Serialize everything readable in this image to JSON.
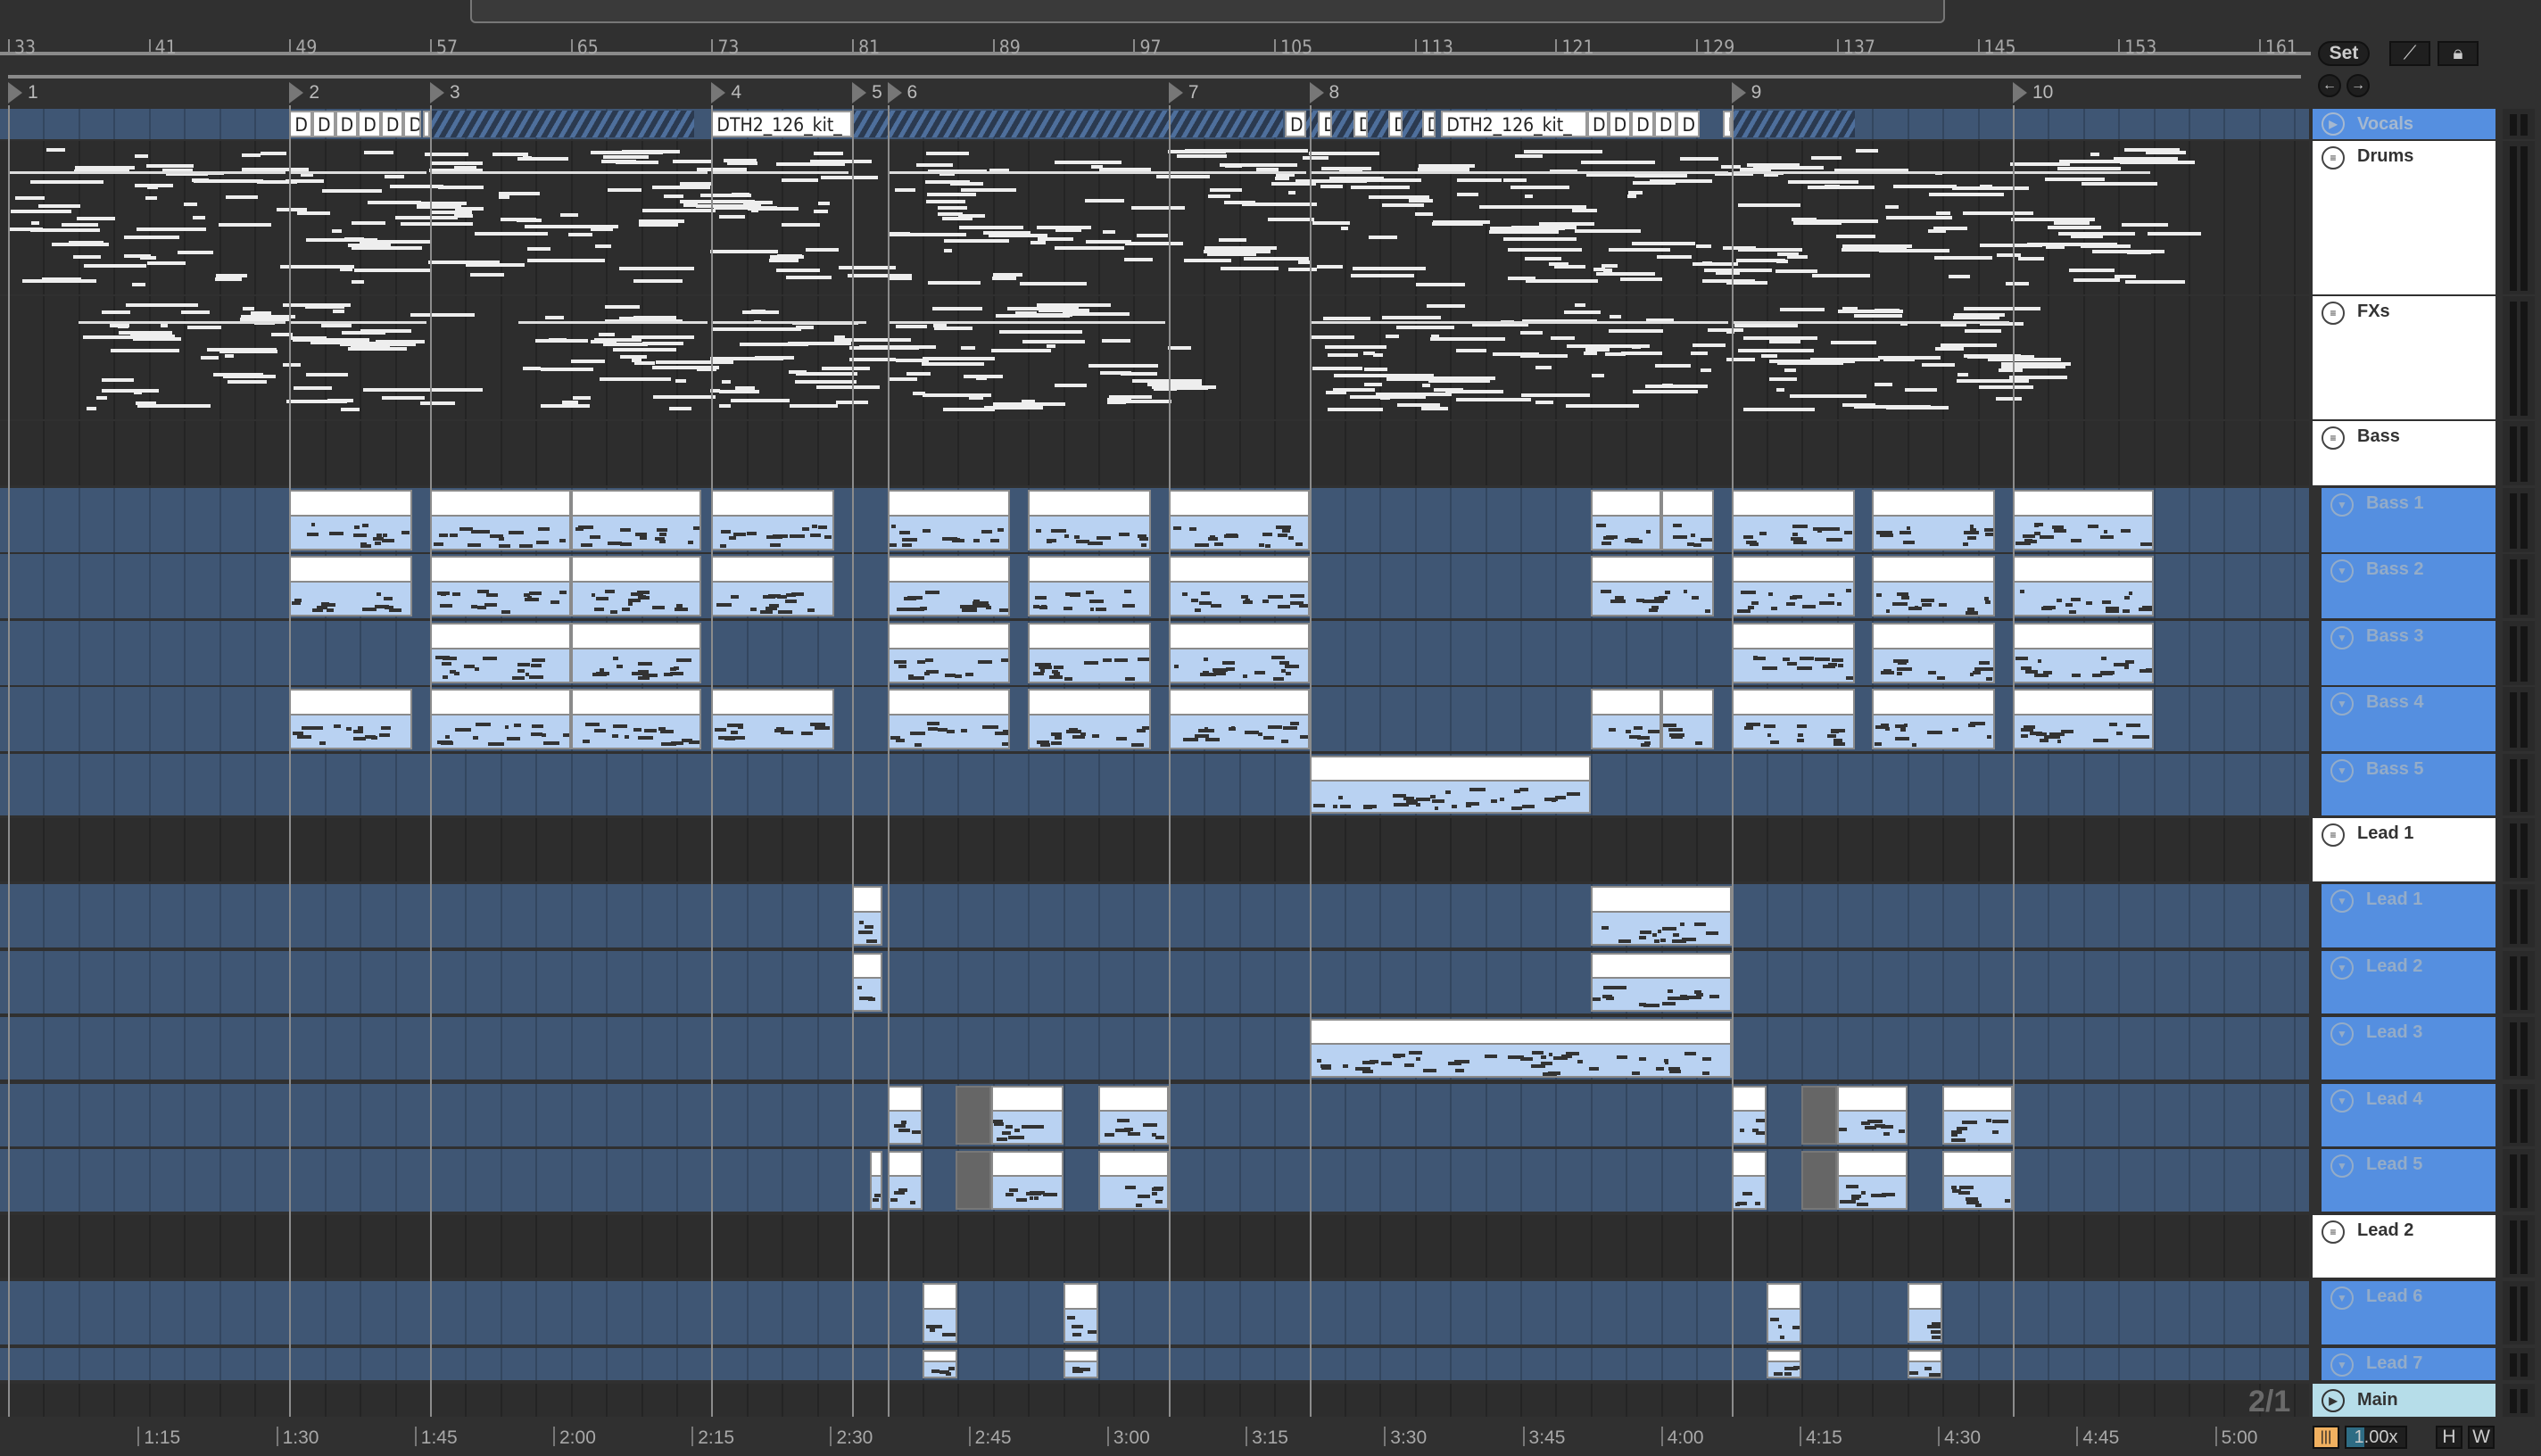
{
  "ruler": {
    "bars": [
      33,
      41,
      49,
      57,
      65,
      73,
      81,
      89,
      97,
      105,
      113,
      121,
      129,
      137,
      145,
      153,
      161
    ]
  },
  "locators": [
    {
      "label": "1",
      "bar": 33
    },
    {
      "label": "2",
      "bar": 49
    },
    {
      "label": "3",
      "bar": 57
    },
    {
      "label": "4",
      "bar": 73
    },
    {
      "label": "5",
      "bar": 81
    },
    {
      "label": "6",
      "bar": 83
    },
    {
      "label": "7",
      "bar": 99
    },
    {
      "label": "8",
      "bar": 107
    },
    {
      "label": "9",
      "bar": 131
    },
    {
      "label": "10",
      "bar": 147
    }
  ],
  "controls": {
    "set_label": "Set",
    "draw_icon": "draw-mode-icon",
    "lock_icon": "lock-icon",
    "prev_icon": "arrow-left-icon",
    "next_icon": "arrow-right-icon"
  },
  "time_signature": "2/1",
  "time_ruler": [
    {
      "label": "1:15",
      "sec": 75
    },
    {
      "label": "1:30",
      "sec": 90
    },
    {
      "label": "1:45",
      "sec": 105
    },
    {
      "label": "2:00",
      "sec": 120
    },
    {
      "label": "2:15",
      "sec": 135
    },
    {
      "label": "2:30",
      "sec": 150
    },
    {
      "label": "2:45",
      "sec": 165
    },
    {
      "label": "3:00",
      "sec": 180
    },
    {
      "label": "3:15",
      "sec": 195
    },
    {
      "label": "3:30",
      "sec": 210
    },
    {
      "label": "3:45",
      "sec": 225
    },
    {
      "label": "4:00",
      "sec": 240
    },
    {
      "label": "4:15",
      "sec": 255
    },
    {
      "label": "4:30",
      "sec": 270
    },
    {
      "label": "4:45",
      "sec": 285
    },
    {
      "label": "5:00",
      "sec": 300
    }
  ],
  "footer": {
    "tempo_follow_icon": "waveform-icon",
    "zoom": "1.00x",
    "h_label": "H",
    "w_label": "W"
  },
  "vocal_clips": [
    {
      "label": "D",
      "start": 49,
      "end": 50.3
    },
    {
      "label": "D",
      "start": 50.3,
      "end": 51.6
    },
    {
      "label": "D",
      "start": 51.6,
      "end": 52.9
    },
    {
      "label": "D",
      "start": 52.9,
      "end": 54.2
    },
    {
      "label": "D",
      "start": 54.2,
      "end": 55.5
    },
    {
      "label": "D",
      "start": 55.5,
      "end": 56.5
    },
    {
      "label": "D",
      "start": 56.6,
      "end": 57
    },
    {
      "label": "DTH2_126_kit_",
      "start": 73,
      "end": 81
    },
    {
      "label": "D",
      "start": 105.6,
      "end": 106.8
    },
    {
      "label": "D",
      "start": 107.5,
      "end": 108.3
    },
    {
      "label": "D",
      "start": 109.5,
      "end": 110.3
    },
    {
      "label": "D",
      "start": 111.5,
      "end": 112.3
    },
    {
      "label": "D",
      "start": 113.4,
      "end": 114.2
    },
    {
      "label": "DTH2_126_kit_",
      "start": 114.5,
      "end": 122.8
    },
    {
      "label": "D",
      "start": 122.8,
      "end": 124
    },
    {
      "label": "D",
      "start": 124,
      "end": 125.3
    },
    {
      "label": "D",
      "start": 125.3,
      "end": 126.6
    },
    {
      "label": "D",
      "start": 126.6,
      "end": 127.9
    },
    {
      "label": "D",
      "start": 127.9,
      "end": 129.2
    },
    {
      "label": "D",
      "start": 130.5,
      "end": 131
    }
  ],
  "vocal_hatch": [
    [
      57,
      72
    ],
    [
      81,
      105.5
    ],
    [
      106.8,
      113.4
    ],
    [
      131,
      138
    ]
  ],
  "tracks": [
    {
      "id": "vocals",
      "name": "Vocals",
      "kind": "vocal",
      "icon": "play-icon"
    },
    {
      "id": "drums",
      "name": "Drums",
      "kind": "group",
      "icon": "group-icon",
      "notes": [
        [
          33,
          49
        ],
        [
          49,
          57
        ],
        [
          57,
          73
        ],
        [
          73,
          81
        ],
        [
          83,
          107
        ],
        [
          107,
          131
        ],
        [
          131,
          155
        ]
      ]
    },
    {
      "id": "fxs",
      "name": "FXs",
      "kind": "group",
      "icon": "group-icon",
      "notes": [
        [
          37,
          49
        ],
        [
          49,
          57
        ],
        [
          62,
          73
        ],
        [
          73,
          82
        ],
        [
          83,
          99
        ],
        [
          107,
          131
        ],
        [
          131,
          147
        ]
      ]
    },
    {
      "id": "bass",
      "name": "Bass",
      "kind": "group",
      "icon": "group-icon"
    },
    {
      "id": "bass1",
      "name": "Bass 1",
      "kind": "child",
      "icon": "fold-icon",
      "clips": [
        [
          49,
          56
        ],
        [
          57,
          65
        ],
        [
          65,
          72.4
        ],
        [
          73,
          80
        ],
        [
          83,
          90
        ],
        [
          91,
          98
        ],
        [
          99,
          107
        ],
        [
          123,
          127
        ],
        [
          127,
          130
        ],
        [
          131,
          138
        ],
        [
          139,
          146
        ],
        [
          147,
          155
        ]
      ]
    },
    {
      "id": "bass2",
      "name": "Bass 2",
      "kind": "child",
      "icon": "fold-icon",
      "clips": [
        [
          49,
          56
        ],
        [
          57,
          65
        ],
        [
          65,
          72.4
        ],
        [
          73,
          80
        ],
        [
          83,
          90
        ],
        [
          91,
          98
        ],
        [
          99,
          107
        ],
        [
          123,
          130
        ],
        [
          131,
          138
        ],
        [
          139,
          146
        ],
        [
          147,
          155
        ]
      ]
    },
    {
      "id": "bass3",
      "name": "Bass 3",
      "kind": "child",
      "icon": "fold-icon",
      "clips": [
        [
          57,
          65
        ],
        [
          65,
          72.4
        ],
        [
          83,
          90
        ],
        [
          91,
          98
        ],
        [
          99,
          107
        ],
        [
          131,
          138
        ],
        [
          139,
          146
        ],
        [
          147,
          155
        ]
      ]
    },
    {
      "id": "bass4",
      "name": "Bass 4",
      "kind": "child",
      "icon": "fold-icon",
      "clips": [
        [
          49,
          56
        ],
        [
          57,
          65
        ],
        [
          65,
          72.4
        ],
        [
          73,
          80
        ],
        [
          83,
          90
        ],
        [
          91,
          98
        ],
        [
          99,
          107
        ],
        [
          123,
          127
        ],
        [
          127,
          130
        ],
        [
          131,
          138
        ],
        [
          139,
          146
        ],
        [
          147,
          155
        ]
      ]
    },
    {
      "id": "bass5",
      "name": "Bass 5",
      "kind": "child",
      "icon": "fold-icon",
      "clips": [
        [
          107,
          123
        ]
      ]
    },
    {
      "id": "lead1g",
      "name": "Lead 1",
      "kind": "group",
      "icon": "group-icon"
    },
    {
      "id": "lead1",
      "name": "Lead 1",
      "kind": "child",
      "icon": "fold-icon",
      "clips": [
        [
          81,
          82.7
        ],
        [
          123,
          131
        ]
      ]
    },
    {
      "id": "lead2",
      "name": "Lead 2",
      "kind": "child",
      "icon": "fold-icon",
      "clips": [
        [
          81,
          82.7
        ],
        [
          123,
          131
        ]
      ]
    },
    {
      "id": "lead3",
      "name": "Lead 3",
      "kind": "child",
      "icon": "fold-icon",
      "clips": [
        [
          107,
          131
        ]
      ]
    },
    {
      "id": "lead4",
      "name": "Lead 4",
      "kind": "child",
      "icon": "fold-icon",
      "clips": [
        [
          83,
          85
        ],
        [
          86.9,
          88.9,
          "g"
        ],
        [
          88.9,
          93
        ],
        [
          95,
          99
        ],
        [
          131,
          133
        ],
        [
          135,
          137,
          "g"
        ],
        [
          137,
          141
        ],
        [
          143,
          147
        ]
      ]
    },
    {
      "id": "lead5",
      "name": "Lead 5",
      "kind": "child",
      "icon": "fold-icon",
      "clips": [
        [
          82,
          82.7
        ],
        [
          83,
          85
        ],
        [
          86.9,
          88.9,
          "g"
        ],
        [
          88.9,
          93
        ],
        [
          95,
          99
        ],
        [
          131,
          133
        ],
        [
          135,
          137,
          "g"
        ],
        [
          137,
          141
        ],
        [
          143,
          147
        ]
      ]
    },
    {
      "id": "lead2g",
      "name": "Lead 2",
      "kind": "group",
      "icon": "group-icon"
    },
    {
      "id": "lead6",
      "name": "Lead 6",
      "kind": "child",
      "icon": "fold-icon",
      "clips": [
        [
          85,
          87
        ],
        [
          93,
          95
        ],
        [
          133,
          135
        ],
        [
          141,
          143
        ]
      ]
    },
    {
      "id": "lead7",
      "name": "Lead 7",
      "kind": "child",
      "icon": "fold-icon",
      "clips": [
        [
          85,
          87
        ],
        [
          93,
          95
        ],
        [
          133,
          135
        ],
        [
          141,
          143
        ]
      ]
    },
    {
      "id": "main",
      "name": "Main",
      "kind": "main",
      "icon": "play-icon"
    }
  ]
}
